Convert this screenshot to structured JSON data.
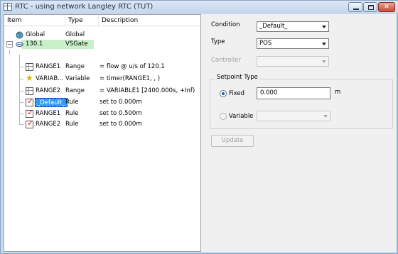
{
  "window": {
    "title": "RTC -  using network Langley RTC (TUT)"
  },
  "tree": {
    "columns": {
      "item": "Item",
      "type": "Type",
      "description": "Description"
    },
    "rows": [
      {
        "item": "Global",
        "type": "Global",
        "description": ""
      },
      {
        "item": "130.1",
        "type": "VSGate",
        "description": ""
      },
      {
        "item": "RANGE1",
        "type": "Range",
        "description": "= flow @ u/s of 120.1"
      },
      {
        "item": "VARIAB...",
        "type": "Variable",
        "description": "= timer(RANGE1, , )"
      },
      {
        "item": "RANGE2",
        "type": "Range",
        "description": "= VARIABLE1 [2400.000s, +Inf)"
      },
      {
        "item": "_Default_",
        "type": "Rule",
        "description": "set to 0.000m"
      },
      {
        "item": "RANGE1",
        "type": "Rule",
        "description": "set to 0.500m"
      },
      {
        "item": "RANGE2",
        "type": "Rule",
        "description": "set to 0.000m"
      }
    ]
  },
  "properties": {
    "condition_label": "Condition",
    "condition_value": "_Default_",
    "type_label": "Type",
    "type_value": "POS",
    "controller_label": "Controller",
    "controller_value": "",
    "setpoint_group_label": "Setpoint Type",
    "fixed_label": "Fixed",
    "fixed_value": "0.000",
    "fixed_unit": "m",
    "variable_label": "Variable",
    "variable_value": "",
    "update_button": "Update"
  },
  "colors": {
    "selection": "#3399ff",
    "vsgate_highlight": "#c9f0c9",
    "rule_check": "#d01010",
    "variable_star": "#e0b000"
  },
  "icons": {
    "global": "globe-icon",
    "vsgate": "gate-icon",
    "range": "range-icon",
    "variable": "star-icon",
    "rule": "rule-check-icon"
  }
}
